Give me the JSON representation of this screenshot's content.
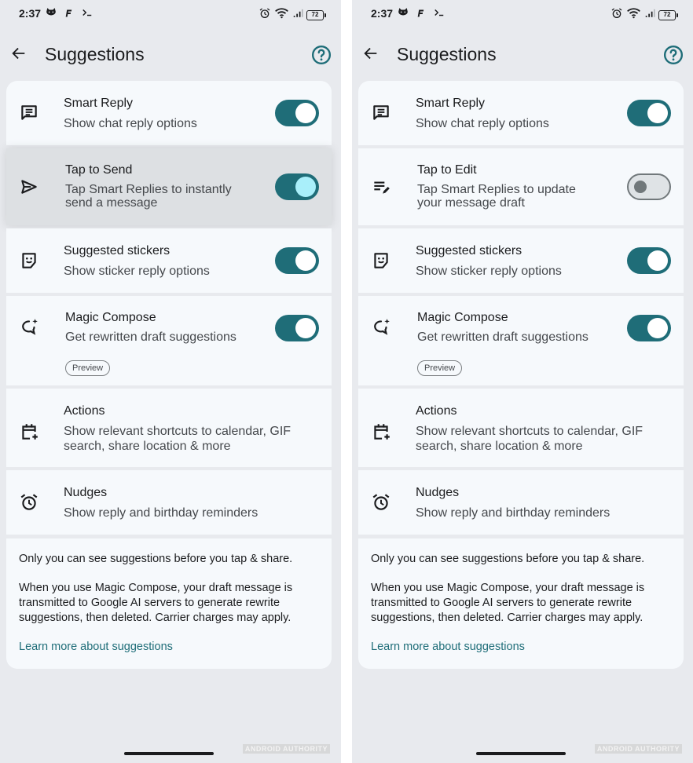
{
  "status_bar": {
    "time": "2:37",
    "battery": "72",
    "icons_left": [
      "cat-face-icon",
      "f-letter-icon",
      "terminal-prompt-icon"
    ],
    "icons_right": [
      "alarm-clock-icon",
      "wifi-icon",
      "signal-icon",
      "battery-icon"
    ]
  },
  "header": {
    "title": "Suggestions",
    "back_icon": "arrow-back-icon",
    "help_icon": "help-circle-icon"
  },
  "screens": [
    {
      "rows": [
        {
          "title": "Smart Reply",
          "desc": [
            "Show chat reply options"
          ],
          "icon": "chat-message-icon",
          "toggle": true
        },
        {
          "title": "Tap to Send",
          "desc": [
            "Tap Smart Replies to instantly",
            "send a message"
          ],
          "icon": "send-arrow-icon",
          "toggle": true,
          "pressed": true
        },
        {
          "title": "Suggested stickers",
          "desc": [
            "Show sticker reply options"
          ],
          "icon": "sticker-smile-icon",
          "toggle": true
        },
        {
          "title": "Magic Compose",
          "desc": [
            "Get rewritten draft suggestions"
          ],
          "icon": "sparkle-chat-icon",
          "toggle": true,
          "chip": "Preview"
        },
        {
          "title": "Actions",
          "desc": [
            "Show relevant shortcuts to calendar, GIF",
            "search, share location & more"
          ],
          "icon": "calendar-add-icon"
        },
        {
          "title": "Nudges",
          "desc": [
            "Show reply and birthday reminders"
          ],
          "icon": "alarm-clock-icon"
        }
      ]
    },
    {
      "rows": [
        {
          "title": "Smart Reply",
          "desc": [
            "Show chat reply options"
          ],
          "icon": "chat-message-icon",
          "toggle": true
        },
        {
          "title": "Tap to Edit",
          "desc": [
            "Tap Smart Replies to update",
            "your message draft"
          ],
          "icon": "edit-lines-icon",
          "toggle": false
        },
        {
          "title": "Suggested stickers",
          "desc": [
            "Show sticker reply options"
          ],
          "icon": "sticker-smile-icon",
          "toggle": true
        },
        {
          "title": "Magic Compose",
          "desc": [
            "Get rewritten draft suggestions"
          ],
          "icon": "sparkle-chat-icon",
          "toggle": true,
          "chip": "Preview"
        },
        {
          "title": "Actions",
          "desc": [
            "Show relevant shortcuts to calendar, GIF",
            "search, share location & more"
          ],
          "icon": "calendar-add-icon"
        },
        {
          "title": "Nudges",
          "desc": [
            "Show reply and birthday reminders"
          ],
          "icon": "alarm-clock-icon"
        }
      ]
    }
  ],
  "info": {
    "privacy_line": "Only you can see suggestions before you tap & share.",
    "magic_compose_lines": [
      "When you use Magic Compose, your draft message is",
      "transmitted to Google AI servers to generate rewrite",
      "suggestions, then deleted. Carrier charges may apply."
    ],
    "learn_more": "Learn more about suggestions"
  },
  "watermark": "ANDROID AUTHORITY",
  "colors": {
    "toggle_on": "#1f6d78",
    "toggle_knob_pressed": "#a9effa",
    "link": "#1e6d78",
    "background": "#e8eaee",
    "card": "#f6f9fc"
  }
}
